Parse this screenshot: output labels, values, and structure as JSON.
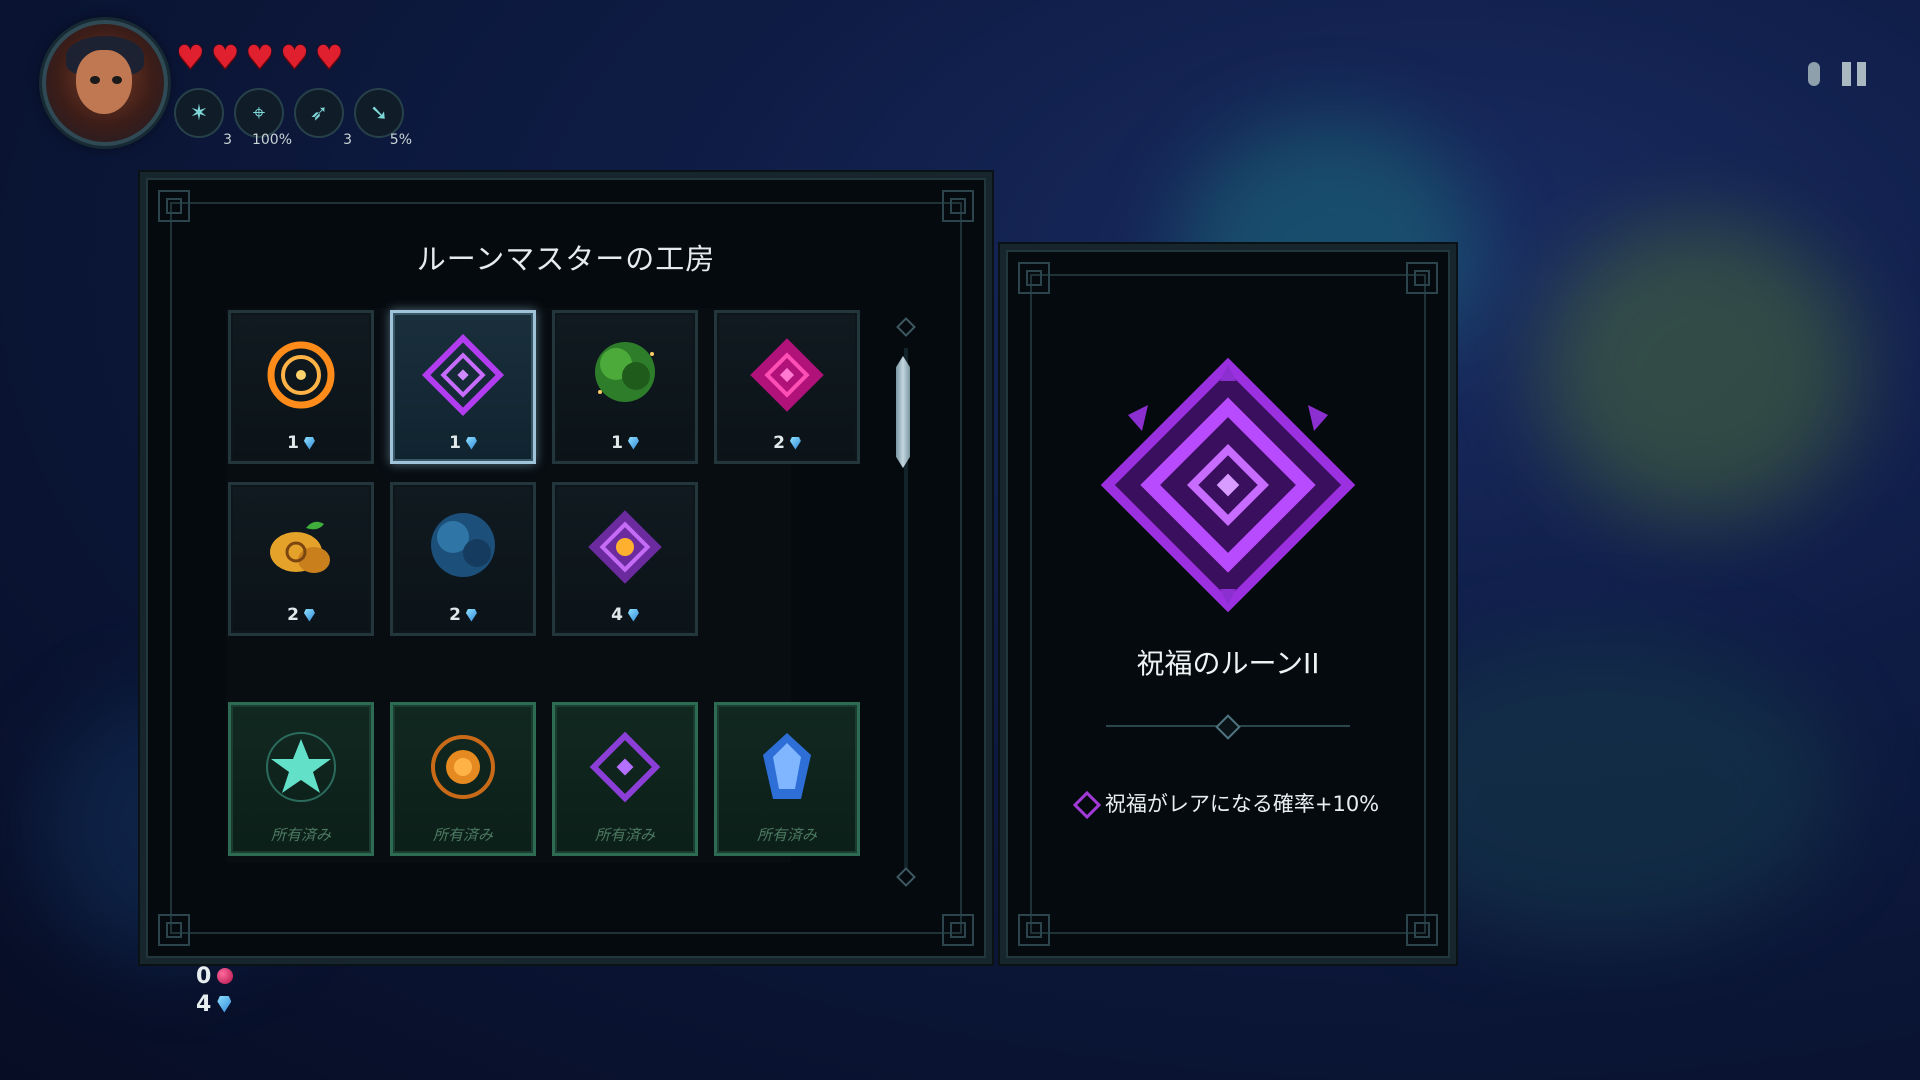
{
  "hud": {
    "hearts": 5,
    "stats": [
      {
        "icon": "star-burst-icon",
        "value": "3"
      },
      {
        "icon": "crosshair-icon",
        "value": "100%"
      },
      {
        "icon": "wing-icon",
        "value": "3"
      },
      {
        "icon": "arrow-hit-icon",
        "value": "5%"
      }
    ]
  },
  "shop": {
    "title": "ルーンマスターの工房",
    "items": [
      {
        "icon": "orange-ring-rune-icon",
        "price": "1",
        "state": "buy"
      },
      {
        "icon": "purple-diamond-rune-icon",
        "price": "1",
        "state": "selected"
      },
      {
        "icon": "green-bush-icon",
        "price": "1",
        "state": "buy"
      },
      {
        "icon": "magenta-diamond-rune-icon",
        "price": "2",
        "state": "buy"
      },
      {
        "icon": "golden-spiral-fruit-icon",
        "price": "2",
        "state": "buy"
      },
      {
        "icon": "blue-bush-icon",
        "price": "2",
        "state": "buy"
      },
      {
        "icon": "purple-sun-rune-icon",
        "price": "4",
        "state": "buy"
      }
    ],
    "owned_items": [
      {
        "icon": "cyan-star-rune-icon",
        "label": "所有済み"
      },
      {
        "icon": "orange-orb-rune-icon",
        "label": "所有済み"
      },
      {
        "icon": "purple-small-diamond-rune-icon",
        "label": "所有済み"
      },
      {
        "icon": "blue-crystal-rune-icon",
        "label": "所有済み"
      }
    ]
  },
  "detail": {
    "icon": "purple-blessing-rune-icon",
    "name": "祝福のルーンII",
    "description": "祝福がレアになる確率+10%"
  },
  "currency": {
    "red_orbs": "0",
    "gems": "4"
  },
  "colors": {
    "accent_purple": "#a13ad6",
    "heart_red": "#e0202e",
    "gem_blue": "#59b7f0",
    "owned_green": "#2d6b52"
  }
}
